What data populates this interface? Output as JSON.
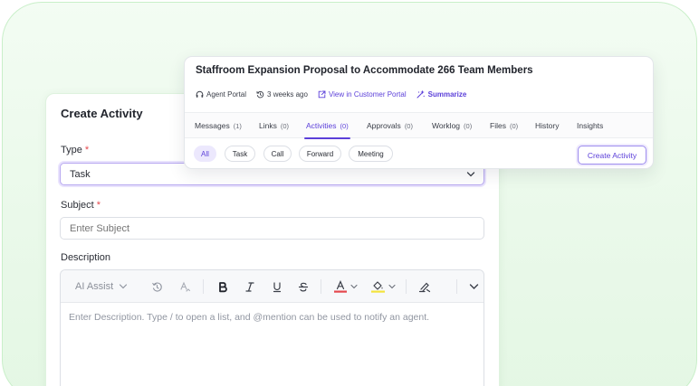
{
  "create_activity": {
    "title": "Create Activity",
    "type_label": "Type",
    "required_mark": "*",
    "type_value": "Task",
    "subject_label": "Subject",
    "subject_placeholder": "Enter Subject",
    "description_label": "Description",
    "toolbar": {
      "ai_assist": "AI Assist",
      "icons": [
        "chevron-down-icon",
        "reset-icon",
        "spellcheck-icon",
        "bold-icon",
        "italic-icon",
        "underline-icon",
        "strikethrough-icon",
        "text-color-icon",
        "highlight-icon",
        "clear-format-icon",
        "expand-chevron-icon"
      ],
      "text_color": "#e5484d",
      "highlight_color": "#f4e33d"
    },
    "description_placeholder": "Enter Description. Type / to open a list, and @mention can be used to notify an agent."
  },
  "ticket": {
    "title": "Staffroom Expansion Proposal to Accommodate 266 Team Members",
    "meta": {
      "portal": "Agent Portal",
      "time": "3 weeks ago",
      "customer_link": "View in Customer Portal",
      "summarize": "Summarize"
    },
    "tabs": [
      {
        "label": "Messages",
        "count": "(1)"
      },
      {
        "label": "Links",
        "count": "(0)"
      },
      {
        "label": "Activities",
        "count": "(0)",
        "active": true
      },
      {
        "label": "Approvals",
        "count": "(0)"
      },
      {
        "label": "Worklog",
        "count": "(0)"
      },
      {
        "label": "Files",
        "count": "(0)"
      },
      {
        "label": "History",
        "count": ""
      },
      {
        "label": "Insights",
        "count": ""
      }
    ],
    "filters": [
      "All",
      "Task",
      "Call",
      "Forward",
      "Meeting"
    ],
    "active_filter": "All",
    "create_button": "Create Activity"
  },
  "colors": {
    "accent": "#5b3fd9",
    "background": "#eaf9ea",
    "required": "#e5484d"
  }
}
